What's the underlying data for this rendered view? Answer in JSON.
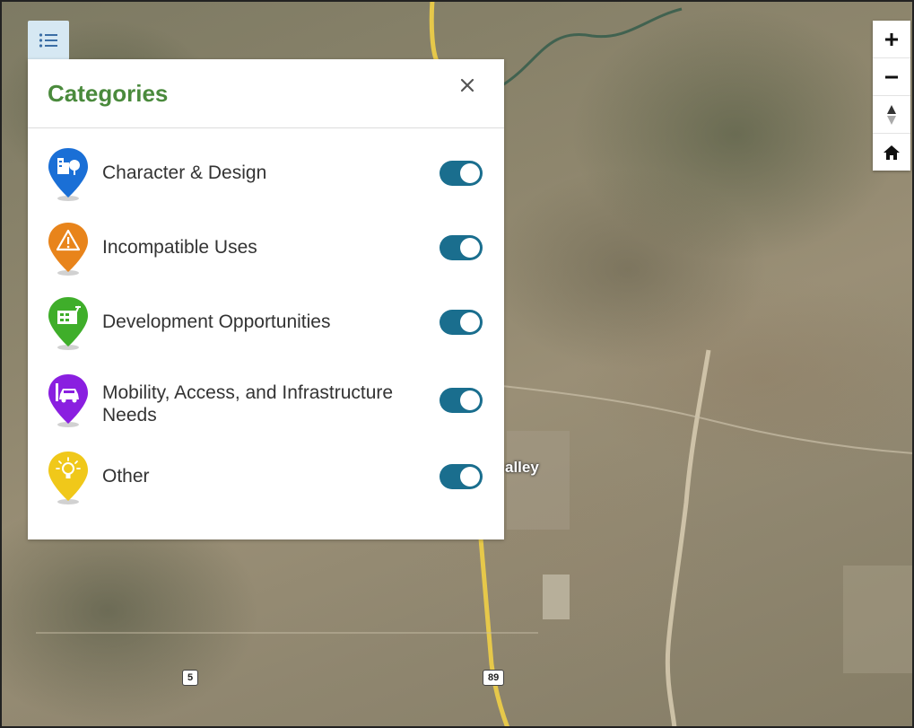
{
  "panel": {
    "title": "Categories",
    "categories": [
      {
        "label": "Character & Design",
        "color": "#1a6fd6",
        "icon": "buildings-tree-icon",
        "enabled": true
      },
      {
        "label": "Incompatible Uses",
        "color": "#e8841b",
        "icon": "warning-icon",
        "enabled": true
      },
      {
        "label": "Development Opportunities",
        "color": "#3fae2a",
        "icon": "building-crane-icon",
        "enabled": true
      },
      {
        "label": "Mobility, Access, and Infrastructure Needs",
        "color": "#8a1fe0",
        "icon": "car-icon",
        "enabled": true
      },
      {
        "label": "Other",
        "color": "#f0c81a",
        "icon": "lightbulb-icon",
        "enabled": true
      }
    ]
  },
  "map": {
    "place_label": "alley",
    "route_labels": [
      "5",
      "89"
    ]
  },
  "colors": {
    "title_green": "#4a8a3c",
    "toggle_on": "#1a6e8e",
    "highway_yellow": "#e6c84a"
  }
}
